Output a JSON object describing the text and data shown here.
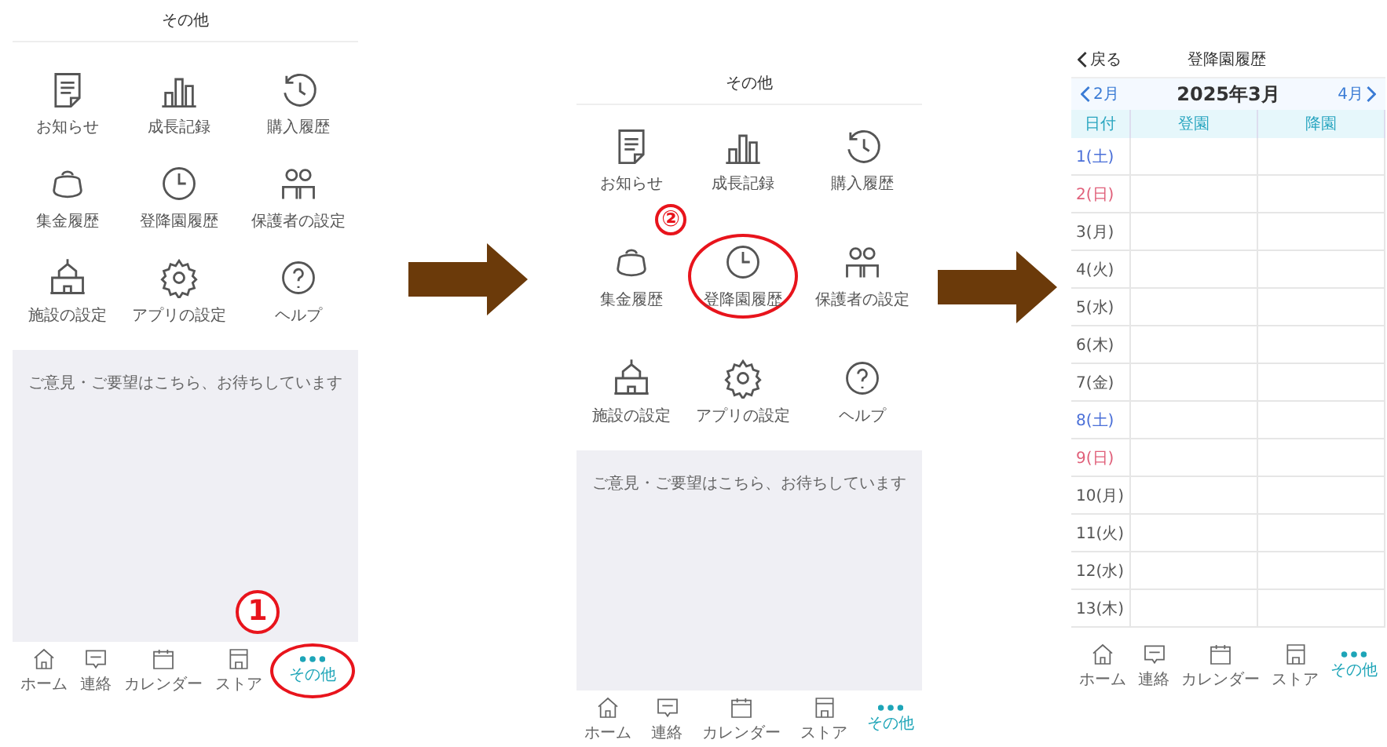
{
  "screens": [
    {
      "kind": "menu",
      "title": "その他",
      "step_label": "1",
      "items": [
        {
          "label": "お知らせ",
          "highlighted": false
        },
        {
          "label": "成長記録",
          "highlighted": false
        },
        {
          "label": "購入履歴",
          "highlighted": false
        },
        {
          "label": "集金履歴",
          "highlighted": false
        },
        {
          "label": "登降園履歴",
          "highlighted": false
        },
        {
          "label": "保護者の設定",
          "highlighted": false
        },
        {
          "label": "施設の設定",
          "highlighted": false
        },
        {
          "label": "アプリの設定",
          "highlighted": false
        },
        {
          "label": "ヘルプ",
          "highlighted": false
        }
      ],
      "banner": "ご意見・ご要望はこちら、お待ちしています",
      "tabs": [
        {
          "label": "ホーム",
          "selected": false,
          "highlighted": false
        },
        {
          "label": "連絡",
          "selected": false,
          "highlighted": false
        },
        {
          "label": "カレンダー",
          "selected": false,
          "highlighted": false
        },
        {
          "label": "ストア",
          "selected": false,
          "highlighted": false
        },
        {
          "label": "その他",
          "selected": true,
          "highlighted": true
        }
      ]
    },
    {
      "kind": "menu",
      "title": "その他",
      "step_label": "②",
      "items": [
        {
          "label": "お知らせ",
          "highlighted": false
        },
        {
          "label": "成長記録",
          "highlighted": false
        },
        {
          "label": "購入履歴",
          "highlighted": false
        },
        {
          "label": "集金履歴",
          "highlighted": false
        },
        {
          "label": "登降園履歴",
          "highlighted": true
        },
        {
          "label": "保護者の設定",
          "highlighted": false
        },
        {
          "label": "施設の設定",
          "highlighted": false
        },
        {
          "label": "アプリの設定",
          "highlighted": false
        },
        {
          "label": "ヘルプ",
          "highlighted": false
        }
      ],
      "banner": "ご意見・ご要望はこちら、お待ちしています",
      "tabs": [
        {
          "label": "ホーム",
          "selected": false,
          "highlighted": false
        },
        {
          "label": "連絡",
          "selected": false,
          "highlighted": false
        },
        {
          "label": "カレンダー",
          "selected": false,
          "highlighted": false
        },
        {
          "label": "ストア",
          "selected": false,
          "highlighted": false
        },
        {
          "label": "その他",
          "selected": true,
          "highlighted": false
        }
      ]
    },
    {
      "kind": "calendar",
      "back": "戻る",
      "title": "登降園履歴",
      "prev": "2月",
      "month": "2025年3月",
      "next": "4月",
      "columns": [
        "日付",
        "登園",
        "降園"
      ],
      "rows": [
        {
          "day": "1(土)",
          "color": "#4a6fd8"
        },
        {
          "day": "2(日)",
          "color": "#e0607a"
        },
        {
          "day": "3(月)",
          "color": "#555555"
        },
        {
          "day": "4(火)",
          "color": "#555555"
        },
        {
          "day": "5(水)",
          "color": "#555555"
        },
        {
          "day": "6(木)",
          "color": "#555555"
        },
        {
          "day": "7(金)",
          "color": "#555555"
        },
        {
          "day": "8(土)",
          "color": "#4a6fd8"
        },
        {
          "day": "9(日)",
          "color": "#e0607a"
        },
        {
          "day": "10(月)",
          "color": "#555555"
        },
        {
          "day": "11(火)",
          "color": "#555555"
        },
        {
          "day": "12(水)",
          "color": "#555555"
        },
        {
          "day": "13(木)",
          "color": "#555555"
        }
      ],
      "tabs": [
        {
          "label": "ホーム",
          "selected": false,
          "highlighted": false
        },
        {
          "label": "連絡",
          "selected": false,
          "highlighted": false
        },
        {
          "label": "カレンダー",
          "selected": false,
          "highlighted": false
        },
        {
          "label": "ストア",
          "selected": false,
          "highlighted": false
        },
        {
          "label": "その他",
          "selected": true,
          "highlighted": false
        }
      ]
    }
  ]
}
